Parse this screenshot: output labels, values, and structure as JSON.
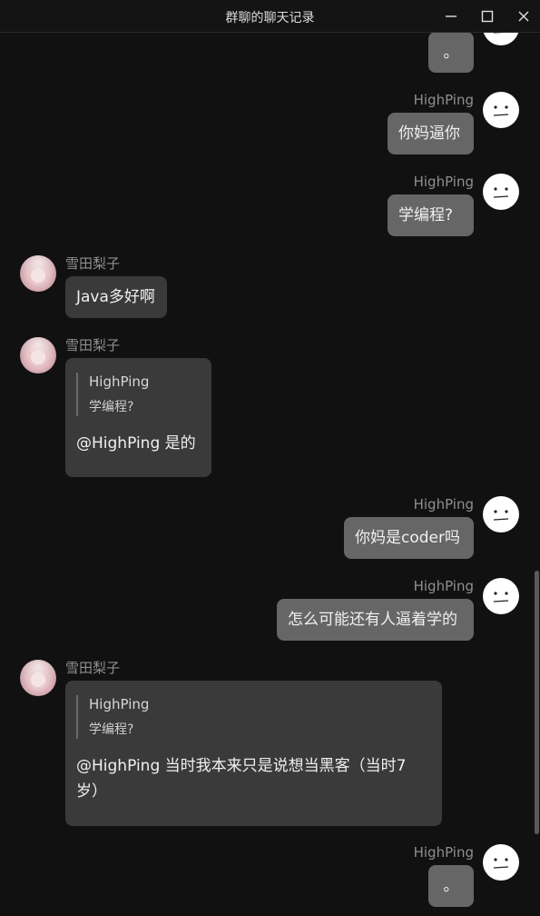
{
  "window": {
    "title": "群聊的聊天记录"
  },
  "icons": {
    "minimize": "minimize-icon",
    "maximize": "maximize-icon",
    "close": "close-icon",
    "self_avatar": "neutral-face-avatar",
    "other_avatar": "anime-girl-avatar"
  },
  "colors": {
    "background": "#111111",
    "self_bubble": "#666666",
    "other_bubble": "#3a3a3a",
    "name_text": "#8f8f8f"
  },
  "messages": [
    {
      "sender": "HighPing",
      "side": "right",
      "text": "。"
    },
    {
      "sender": "HighPing",
      "side": "right",
      "text": "你妈逼你"
    },
    {
      "sender": "HighPing",
      "side": "right",
      "text": "学编程?"
    },
    {
      "sender": "雪田梨子",
      "side": "left",
      "text": "Java多好啊"
    },
    {
      "sender": "雪田梨子",
      "side": "left",
      "quote": {
        "name": "HighPing",
        "text": "学编程?"
      },
      "text": "@HighPing 是的"
    },
    {
      "sender": "HighPing",
      "side": "right",
      "text": "你妈是coder吗"
    },
    {
      "sender": "HighPing",
      "side": "right",
      "text": "怎么可能还有人逼着学的"
    },
    {
      "sender": "雪田梨子",
      "side": "left",
      "quote": {
        "name": "HighPing",
        "text": "学编程?"
      },
      "text": "@HighPing 当时我本来只是说想当黑客（当时7岁）"
    },
    {
      "sender": "HighPing",
      "side": "right",
      "text": "。"
    }
  ]
}
